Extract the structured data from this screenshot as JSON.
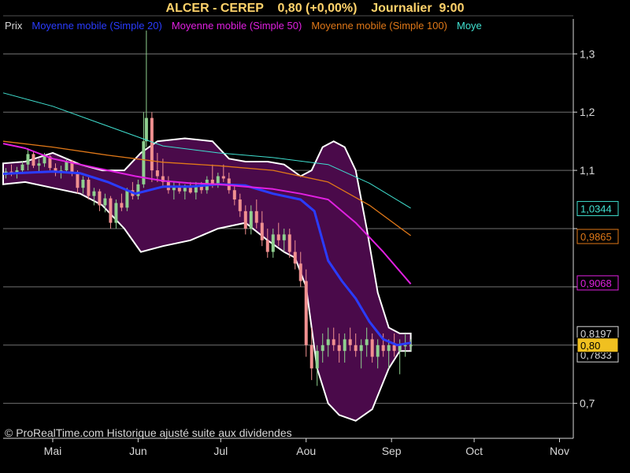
{
  "title": "ALCER - CEREP    0,80 (+0,00%)    Journalier  9:00",
  "copyright": "© ProRealTime.com Historique ajusté suite aux dividendes",
  "legend": [
    {
      "label": "Prix",
      "color": "#d8d8d8"
    },
    {
      "label": "Moyenne mobile (Simple 20)",
      "color": "#2a3cff"
    },
    {
      "label": "Moyenne mobile (Simple 50)",
      "color": "#e020e0"
    },
    {
      "label": "Moyenne mobile (Simple 100)",
      "color": "#e07818"
    },
    {
      "label": "Moye",
      "color": "#40e0d0"
    }
  ],
  "chart_data": {
    "type": "candlestick",
    "y_ticks": [
      "1,3",
      "1,2",
      "1,1",
      "0,7"
    ],
    "y_tick_values": [
      1.3,
      1.2,
      1.1,
      0.7
    ],
    "ylim": [
      0.64,
      1.36
    ],
    "x_ticks": [
      "Mai",
      "Jun",
      "Jul",
      "Aou",
      "Sep",
      "Oct",
      "Nov"
    ],
    "x_tick_days": [
      0,
      31,
      61,
      92,
      123,
      153,
      184
    ],
    "xlim_days": [
      -18,
      189
    ],
    "last_day": 130,
    "value_labels": [
      {
        "text": "1,0344",
        "value": 1.0344,
        "color": "#40e0d0",
        "fill": "#000000"
      },
      {
        "text": "0,9865",
        "value": 0.9865,
        "color": "#e07818",
        "fill": "#000000"
      },
      {
        "text": "0,9068",
        "value": 0.9068,
        "color": "#e020e0",
        "fill": "#000000"
      },
      {
        "text": "0,8197",
        "value": 0.8197,
        "color": "#d8d8d8",
        "fill": "#000000"
      },
      {
        "text": "0,7833",
        "value": 0.7833,
        "color": "#d8d8d8",
        "fill": "#000000"
      },
      {
        "text": "0,80",
        "value": 0.8,
        "color": "#000000",
        "fill": "#f0c020"
      }
    ],
    "series": [
      {
        "name": "Moyenne mobile (Simple 20)",
        "color": "#2a3cff",
        "points": [
          [
            -18,
            1.094
          ],
          [
            -10,
            1.096
          ],
          [
            0,
            1.098
          ],
          [
            10,
            1.095
          ],
          [
            20,
            1.08
          ],
          [
            30,
            1.06
          ],
          [
            40,
            1.072
          ],
          [
            50,
            1.072
          ],
          [
            60,
            1.076
          ],
          [
            70,
            1.074
          ],
          [
            80,
            1.06
          ],
          [
            90,
            1.05
          ],
          [
            95,
            1.03
          ],
          [
            100,
            0.945
          ],
          [
            105,
            0.91
          ],
          [
            110,
            0.88
          ],
          [
            115,
            0.84
          ],
          [
            120,
            0.81
          ],
          [
            125,
            0.8
          ],
          [
            130,
            0.804
          ]
        ]
      },
      {
        "name": "Moyenne mobile (Simple 50)",
        "color": "#e020e0",
        "points": [
          [
            -18,
            1.146
          ],
          [
            -10,
            1.138
          ],
          [
            0,
            1.12
          ],
          [
            10,
            1.11
          ],
          [
            20,
            1.1
          ],
          [
            30,
            1.09
          ],
          [
            40,
            1.082
          ],
          [
            50,
            1.078
          ],
          [
            60,
            1.076
          ],
          [
            70,
            1.072
          ],
          [
            80,
            1.068
          ],
          [
            90,
            1.06
          ],
          [
            100,
            1.05
          ],
          [
            110,
            1.01
          ],
          [
            120,
            0.96
          ],
          [
            130,
            0.905
          ]
        ]
      },
      {
        "name": "Moyenne mobile (Simple 100)",
        "color": "#e07818",
        "points": [
          [
            -18,
            1.15
          ],
          [
            0,
            1.14
          ],
          [
            20,
            1.126
          ],
          [
            40,
            1.114
          ],
          [
            60,
            1.108
          ],
          [
            80,
            1.1
          ],
          [
            100,
            1.08
          ],
          [
            115,
            1.04
          ],
          [
            130,
            0.988
          ]
        ]
      },
      {
        "name": "Moye",
        "color": "#40e0d0",
        "points": [
          [
            -18,
            1.233
          ],
          [
            0,
            1.21
          ],
          [
            20,
            1.176
          ],
          [
            40,
            1.142
          ],
          [
            60,
            1.13
          ],
          [
            80,
            1.122
          ],
          [
            100,
            1.11
          ],
          [
            115,
            1.078
          ],
          [
            130,
            1.035
          ]
        ]
      }
    ],
    "band_upper": [
      [
        -18,
        1.112
      ],
      [
        -10,
        1.115
      ],
      [
        0,
        1.13
      ],
      [
        10,
        1.11
      ],
      [
        18,
        1.1
      ],
      [
        26,
        1.1
      ],
      [
        32,
        1.13
      ],
      [
        38,
        1.15
      ],
      [
        48,
        1.155
      ],
      [
        58,
        1.15
      ],
      [
        64,
        1.12
      ],
      [
        70,
        1.115
      ],
      [
        78,
        1.115
      ],
      [
        84,
        1.11
      ],
      [
        90,
        1.09
      ],
      [
        94,
        1.1
      ],
      [
        98,
        1.14
      ],
      [
        102,
        1.15
      ],
      [
        106,
        1.14
      ],
      [
        110,
        1.1
      ],
      [
        114,
        1.0
      ],
      [
        118,
        0.89
      ],
      [
        122,
        0.83
      ],
      [
        126,
        0.82
      ],
      [
        130,
        0.82
      ]
    ],
    "band_lower": [
      [
        -18,
        1.076
      ],
      [
        -10,
        1.08
      ],
      [
        0,
        1.07
      ],
      [
        10,
        1.06
      ],
      [
        18,
        1.04
      ],
      [
        26,
        1.0
      ],
      [
        32,
        0.96
      ],
      [
        40,
        0.97
      ],
      [
        50,
        0.98
      ],
      [
        60,
        1.0
      ],
      [
        70,
        1.01
      ],
      [
        78,
        0.98
      ],
      [
        84,
        0.96
      ],
      [
        88,
        0.95
      ],
      [
        92,
        0.9
      ],
      [
        96,
        0.76
      ],
      [
        100,
        0.7
      ],
      [
        104,
        0.68
      ],
      [
        110,
        0.67
      ],
      [
        116,
        0.69
      ],
      [
        122,
        0.76
      ],
      [
        126,
        0.79
      ],
      [
        130,
        0.79
      ]
    ],
    "candles": [
      [
        -17,
        1.092,
        1.104,
        1.086,
        1.098
      ],
      [
        -15,
        1.098,
        1.11,
        1.09,
        1.094
      ],
      [
        -13,
        1.094,
        1.106,
        1.086,
        1.1
      ],
      [
        -11,
        1.1,
        1.116,
        1.094,
        1.11
      ],
      [
        -9,
        1.11,
        1.138,
        1.1,
        1.128
      ],
      [
        -7,
        1.128,
        1.132,
        1.104,
        1.108
      ],
      [
        -5,
        1.108,
        1.12,
        1.098,
        1.112
      ],
      [
        -3,
        1.112,
        1.13,
        1.106,
        1.124
      ],
      [
        -1,
        1.124,
        1.126,
        1.1,
        1.104
      ],
      [
        1,
        1.104,
        1.112,
        1.09,
        1.096
      ],
      [
        3,
        1.096,
        1.108,
        1.086,
        1.1
      ],
      [
        5,
        1.1,
        1.12,
        1.096,
        1.116
      ],
      [
        7,
        1.116,
        1.118,
        1.09,
        1.094
      ],
      [
        9,
        1.094,
        1.1,
        1.06,
        1.07
      ],
      [
        11,
        1.07,
        1.09,
        1.06,
        1.084
      ],
      [
        13,
        1.084,
        1.088,
        1.05,
        1.056
      ],
      [
        15,
        1.056,
        1.07,
        1.04,
        1.064
      ],
      [
        17,
        1.064,
        1.068,
        1.03,
        1.04
      ],
      [
        19,
        1.04,
        1.06,
        1.028,
        1.052
      ],
      [
        21,
        1.052,
        1.056,
        1.0,
        1.01
      ],
      [
        23,
        1.01,
        1.05,
        1.0,
        1.044
      ],
      [
        25,
        1.044,
        1.06,
        1.03,
        1.036
      ],
      [
        27,
        1.036,
        1.07,
        1.03,
        1.066
      ],
      [
        29,
        1.066,
        1.08,
        1.05,
        1.056
      ],
      [
        31,
        1.056,
        1.084,
        1.05,
        1.076
      ],
      [
        33,
        1.076,
        1.2,
        1.07,
        1.15
      ],
      [
        34,
        1.15,
        1.34,
        1.14,
        1.19
      ],
      [
        36,
        1.19,
        1.2,
        1.08,
        1.1
      ],
      [
        38,
        1.1,
        1.13,
        1.08,
        1.09
      ],
      [
        40,
        1.09,
        1.12,
        1.07,
        1.08
      ],
      [
        42,
        1.08,
        1.09,
        1.06,
        1.066
      ],
      [
        44,
        1.066,
        1.08,
        1.05,
        1.072
      ],
      [
        46,
        1.072,
        1.08,
        1.06,
        1.064
      ],
      [
        48,
        1.064,
        1.076,
        1.05,
        1.07
      ],
      [
        50,
        1.07,
        1.08,
        1.06,
        1.062
      ],
      [
        52,
        1.062,
        1.08,
        1.05,
        1.074
      ],
      [
        54,
        1.074,
        1.08,
        1.06,
        1.066
      ],
      [
        56,
        1.066,
        1.09,
        1.06,
        1.084
      ],
      [
        58,
        1.084,
        1.11,
        1.07,
        1.076
      ],
      [
        60,
        1.076,
        1.096,
        1.07,
        1.09
      ],
      [
        62,
        1.09,
        1.11,
        1.08,
        1.086
      ],
      [
        64,
        1.086,
        1.096,
        1.06,
        1.066
      ],
      [
        66,
        1.066,
        1.076,
        1.04,
        1.05
      ],
      [
        68,
        1.05,
        1.06,
        1.02,
        1.03
      ],
      [
        70,
        1.03,
        1.04,
        0.99,
        1.0
      ],
      [
        72,
        1.0,
        1.04,
        0.99,
        1.03
      ],
      [
        74,
        1.03,
        1.05,
        1.0,
        1.01
      ],
      [
        76,
        1.01,
        1.03,
        0.97,
        0.98
      ],
      [
        78,
        0.98,
        1.0,
        0.95,
        0.96
      ],
      [
        80,
        0.96,
        1.0,
        0.95,
        0.99
      ],
      [
        82,
        0.99,
        1.01,
        0.97,
        0.98
      ],
      [
        84,
        0.98,
        1.0,
        0.96,
        0.99
      ],
      [
        86,
        0.99,
        1.0,
        0.95,
        0.96
      ],
      [
        88,
        0.96,
        0.98,
        0.93,
        0.94
      ],
      [
        90,
        0.94,
        0.96,
        0.9,
        0.91
      ],
      [
        92,
        0.91,
        0.93,
        0.78,
        0.8
      ],
      [
        94,
        0.8,
        0.83,
        0.74,
        0.76
      ],
      [
        96,
        0.76,
        0.8,
        0.73,
        0.79
      ],
      [
        98,
        0.79,
        0.82,
        0.77,
        0.8
      ],
      [
        100,
        0.8,
        0.83,
        0.78,
        0.81
      ],
      [
        102,
        0.81,
        0.83,
        0.79,
        0.8
      ],
      [
        104,
        0.8,
        0.82,
        0.77,
        0.79
      ],
      [
        106,
        0.79,
        0.82,
        0.77,
        0.81
      ],
      [
        108,
        0.81,
        0.83,
        0.79,
        0.8
      ],
      [
        110,
        0.8,
        0.82,
        0.78,
        0.79
      ],
      [
        112,
        0.79,
        0.81,
        0.76,
        0.8
      ],
      [
        114,
        0.8,
        0.83,
        0.78,
        0.81
      ],
      [
        116,
        0.81,
        0.82,
        0.77,
        0.78
      ],
      [
        118,
        0.78,
        0.81,
        0.76,
        0.8
      ],
      [
        120,
        0.8,
        0.82,
        0.78,
        0.79
      ],
      [
        122,
        0.79,
        0.81,
        0.76,
        0.8
      ],
      [
        124,
        0.8,
        0.82,
        0.78,
        0.79
      ],
      [
        126,
        0.79,
        0.81,
        0.75,
        0.8
      ],
      [
        128,
        0.8,
        0.82,
        0.78,
        0.8
      ],
      [
        130,
        0.8,
        0.81,
        0.79,
        0.8
      ]
    ]
  }
}
